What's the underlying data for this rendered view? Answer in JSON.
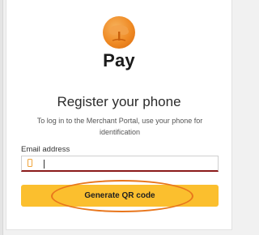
{
  "brand": {
    "name": "Pay",
    "logo_icon": "tree-coin-icon",
    "logo_color": "#ef8a24"
  },
  "register": {
    "title": "Register your phone",
    "subtitle": "To log in to the Merchant Portal, use your phone for identification"
  },
  "email": {
    "label": "Email address",
    "value": "",
    "placeholder": "",
    "icon": "phone-icon"
  },
  "actions": {
    "generate_label": "Generate QR code",
    "button_color": "#fbbf2e"
  },
  "annotation": {
    "color": "#e8761c"
  }
}
